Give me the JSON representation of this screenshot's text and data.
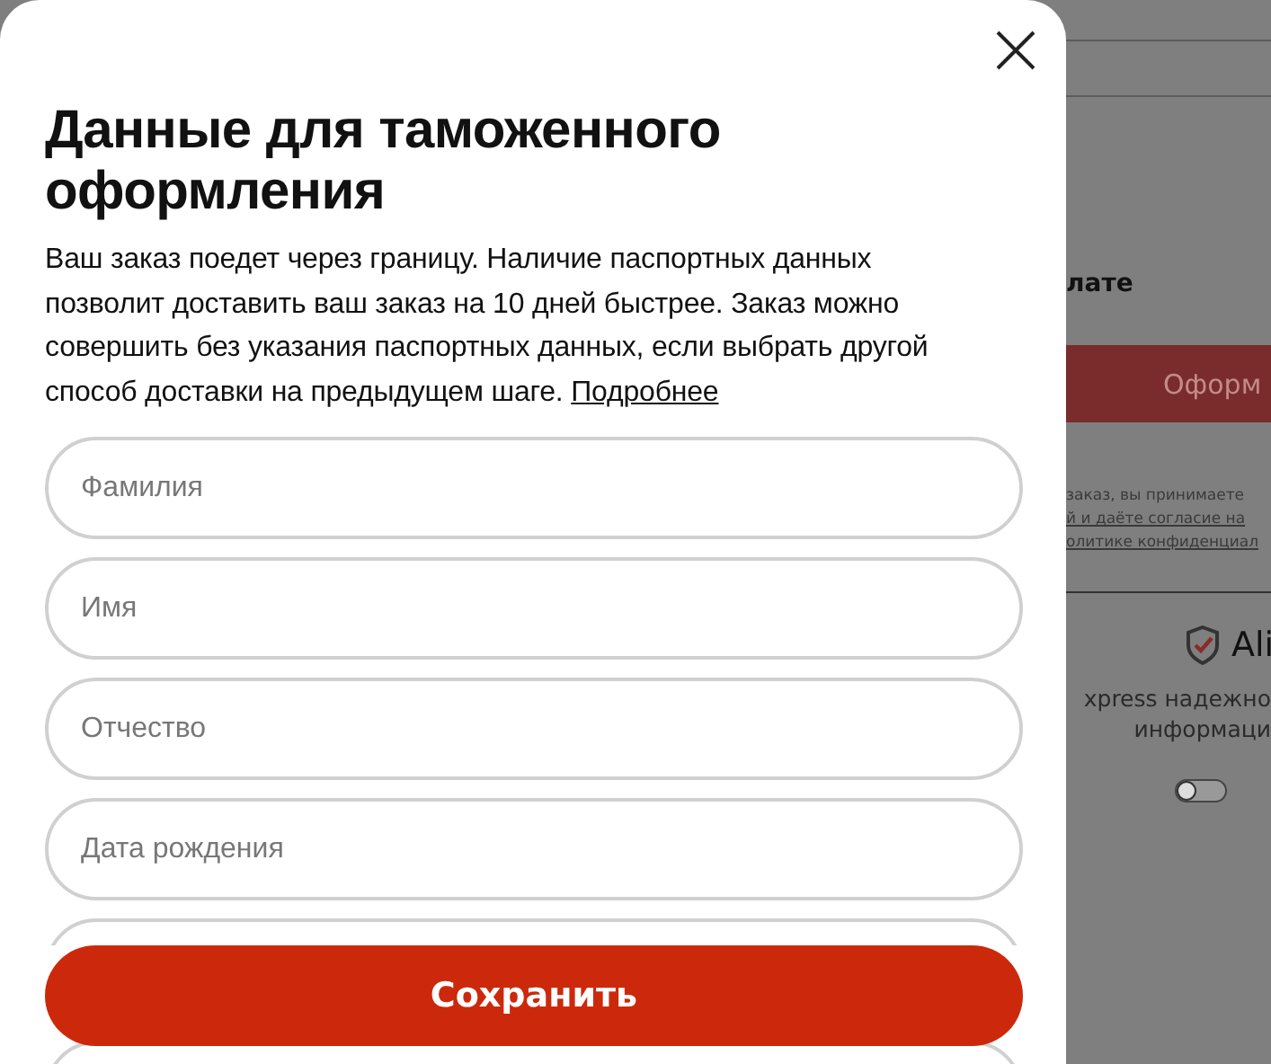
{
  "dialog": {
    "title": "Данные для таможенного оформления",
    "description": "Ваш заказ поедет через границу. Наличие паспортных данных позволит доставить ваш заказ на 10 дней быстрее. Заказ можно совершить без указания паспортных данных, если выбрать другой способ доставки на предыдущем шаге.",
    "more_link": "Подробнее",
    "fields": [
      {
        "kind": "text",
        "placeholder": "Фамилия"
      },
      {
        "kind": "text",
        "placeholder": "Имя"
      },
      {
        "kind": "text",
        "placeholder": "Отчество"
      },
      {
        "kind": "text",
        "placeholder": "Дата рождения"
      },
      {
        "kind": "text"
      },
      {
        "kind": "text"
      }
    ],
    "save_button": "Сохранить"
  },
  "background_page": {
    "heading": "лате",
    "order_button": "Оформ",
    "terms_lines": [
      "заказ, вы принимаете",
      "й и даёте согласие на",
      "олитике конфиденциал"
    ],
    "brand": "Ali",
    "security_lines": [
      "xpress надежно",
      "информаци"
    ]
  }
}
